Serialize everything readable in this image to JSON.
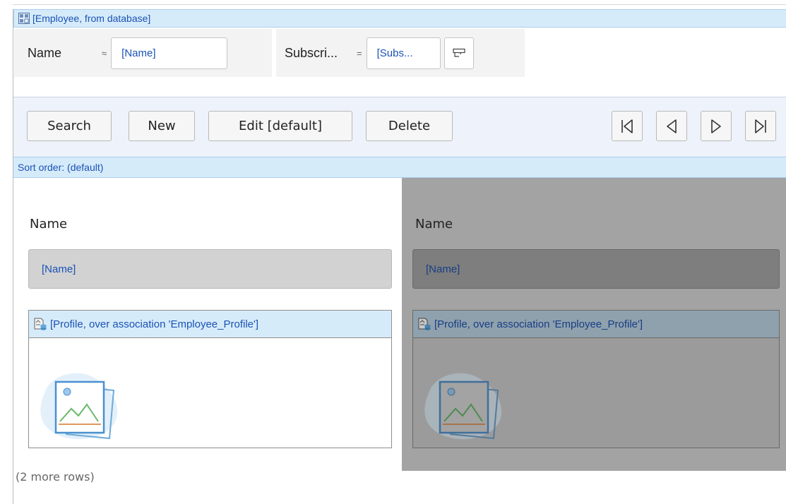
{
  "title": {
    "text": "[Employee, from database]",
    "icon": "entity-icon"
  },
  "filters": [
    {
      "label": "Name",
      "operator": "≈",
      "value": "[Name]"
    },
    {
      "label": "Subscri...",
      "operator": "=",
      "value": "[Subs..."
    }
  ],
  "toolbar": {
    "search_label": "Search",
    "new_label": "New",
    "edit_label": "Edit [default]",
    "delete_label": "Delete",
    "nav_icons": [
      "first-icon",
      "previous-icon",
      "next-icon",
      "last-icon"
    ]
  },
  "sort": {
    "text": "Sort order: (default)"
  },
  "cards": [
    {
      "label": "Name",
      "field_value": "[Name]",
      "profile_title": "[Profile, over association 'Employee_Profile']",
      "image_icon": "image-placeholder-icon"
    },
    {
      "label": "Name",
      "field_value": "[Name]",
      "profile_title": "[Profile, over association 'Employee_Profile']",
      "image_icon": "image-placeholder-icon"
    }
  ],
  "footer": {
    "more_rows": "(2 more rows)"
  },
  "colors": {
    "accent_text": "#1a52b5",
    "header_bg": "#d6ebfa",
    "selected_card_bg": "#a3a3a3"
  }
}
